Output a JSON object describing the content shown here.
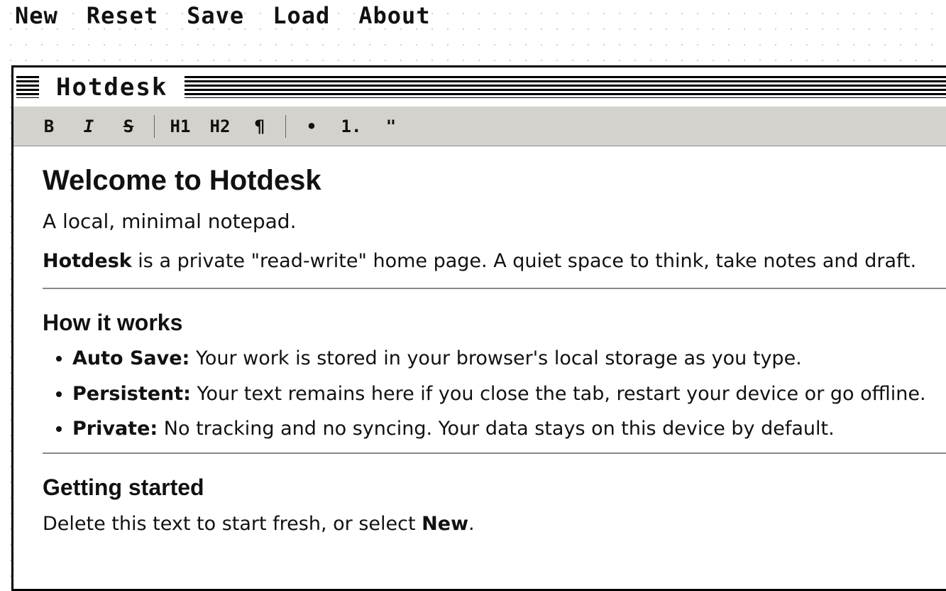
{
  "menu": {
    "new": "New",
    "reset": "Reset",
    "save": "Save",
    "load": "Load",
    "about": "About"
  },
  "window": {
    "title": "Hotdesk"
  },
  "toolbar": {
    "bold": "B",
    "italic": "I",
    "strike": "S",
    "h1": "H1",
    "h2": "H2",
    "paragraph": "¶",
    "bullet_list": "•",
    "ordered_list": "1.",
    "quote": "\""
  },
  "document": {
    "heading": "Welcome to Hotdesk",
    "subtitle": "A local, minimal notepad.",
    "intro": {
      "bold": "Hotdesk",
      "rest": " is a private \"read-write\" home page. A quiet space to think, take notes and draft."
    },
    "section1": {
      "heading": "How it works",
      "items": [
        {
          "label": "Auto Save:",
          "text": " Your work is stored in your browser's local storage as you type."
        },
        {
          "label": "Persistent:",
          "text": " Your text remains here if you close the tab, restart your device or go offline."
        },
        {
          "label": "Private:",
          "text": " No tracking and no syncing. Your data stays on this device by default."
        }
      ]
    },
    "section2": {
      "heading": "Getting started",
      "text_before": "Delete this text to start fresh, or select ",
      "bold": "New",
      "text_after": "."
    }
  },
  "icons": {
    "window_menu": "hamburger-stripes-icon",
    "titlebar_pattern": "stripes-pattern"
  },
  "colors": {
    "toolbar_bg": "#d4d2cd",
    "border": "#000000",
    "text": "#111111",
    "rule": "#8a8a8a"
  }
}
